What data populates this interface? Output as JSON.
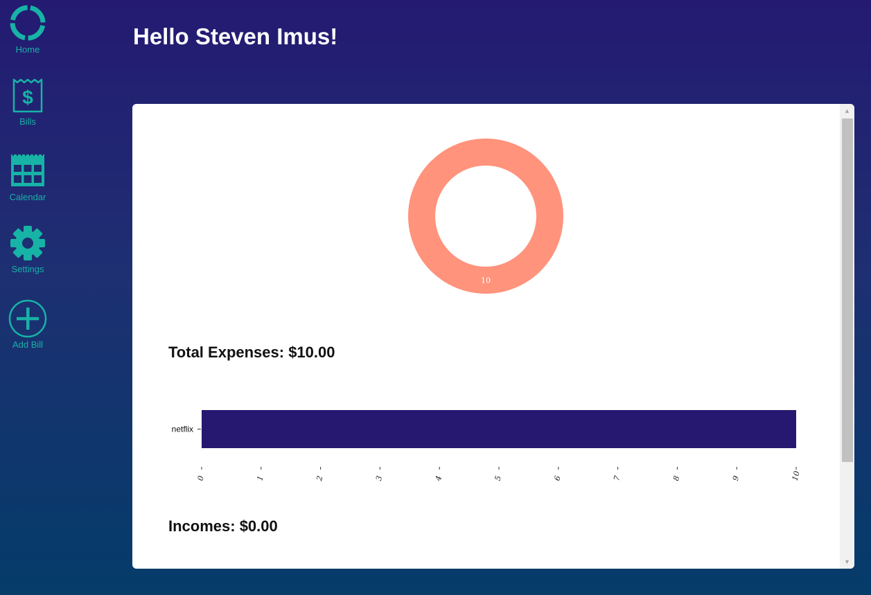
{
  "nav": {
    "items": [
      {
        "label": "Home",
        "icon": "loading-ring-icon"
      },
      {
        "label": "Bills",
        "icon": "receipt-dollar-icon"
      },
      {
        "label": "Calendar",
        "icon": "calendar-icon"
      },
      {
        "label": "Settings",
        "icon": "gear-icon"
      },
      {
        "label": "Add Bill",
        "icon": "plus-circle-icon"
      }
    ]
  },
  "greeting": "Hello Steven Imus!",
  "summary": {
    "total_expenses": "Total Expenses: $10.00",
    "incomes": "Incomes: $0.00"
  },
  "colors": {
    "accent": "#17b3a6",
    "donut": "#ff937c",
    "bar": "#261871"
  },
  "chart_data": [
    {
      "type": "pie",
      "labels": [
        "netflix"
      ],
      "values": [
        10
      ],
      "data_labels": [
        "10"
      ]
    },
    {
      "type": "bar",
      "orientation": "horizontal",
      "categories": [
        "netflix"
      ],
      "values": [
        10
      ],
      "xlim": [
        0,
        10
      ],
      "x_ticks": [
        "0",
        "1",
        "2",
        "3",
        "4",
        "5",
        "6",
        "7",
        "8",
        "9",
        "10"
      ],
      "grid": false
    }
  ]
}
